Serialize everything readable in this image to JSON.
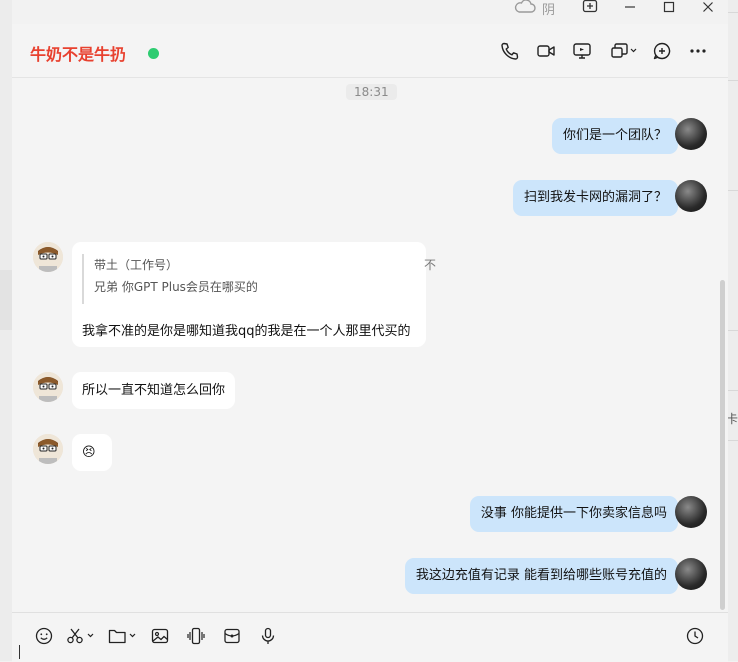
{
  "window": {
    "weather": {
      "icon": "cloud-icon",
      "label": "阴"
    }
  },
  "header": {
    "title": "牛奶不是牛扔",
    "status_color": "#2ecc71",
    "actions": [
      "phone-icon",
      "video-icon",
      "screen-share-icon",
      "window-sync-icon",
      "add-member-icon",
      "more-icon"
    ]
  },
  "messages": {
    "timestamp": "18:31",
    "sent": [
      "你们是一个团队？",
      "扫到我发卡网的漏洞了？",
      "没事 你能提供一下你卖家信息吗",
      "我这边充值有记录 能看到给哪些账号充值的"
    ],
    "reply": {
      "quote_name": "带土（工作号）",
      "quote_text": "兄弟 你GPT Plus会员在哪买的",
      "pin": "不",
      "text": "我拿不准的是你是哪知道我qq的我是在一个人那里代买的"
    },
    "received": [
      "所以一直不知道怎么回你",
      "😣"
    ]
  },
  "sidebar_right": {
    "char": "卡"
  },
  "colors": {
    "title": "#e8412f",
    "sent_bubble": "#cce5fb",
    "received_bubble": "#ffffff"
  }
}
